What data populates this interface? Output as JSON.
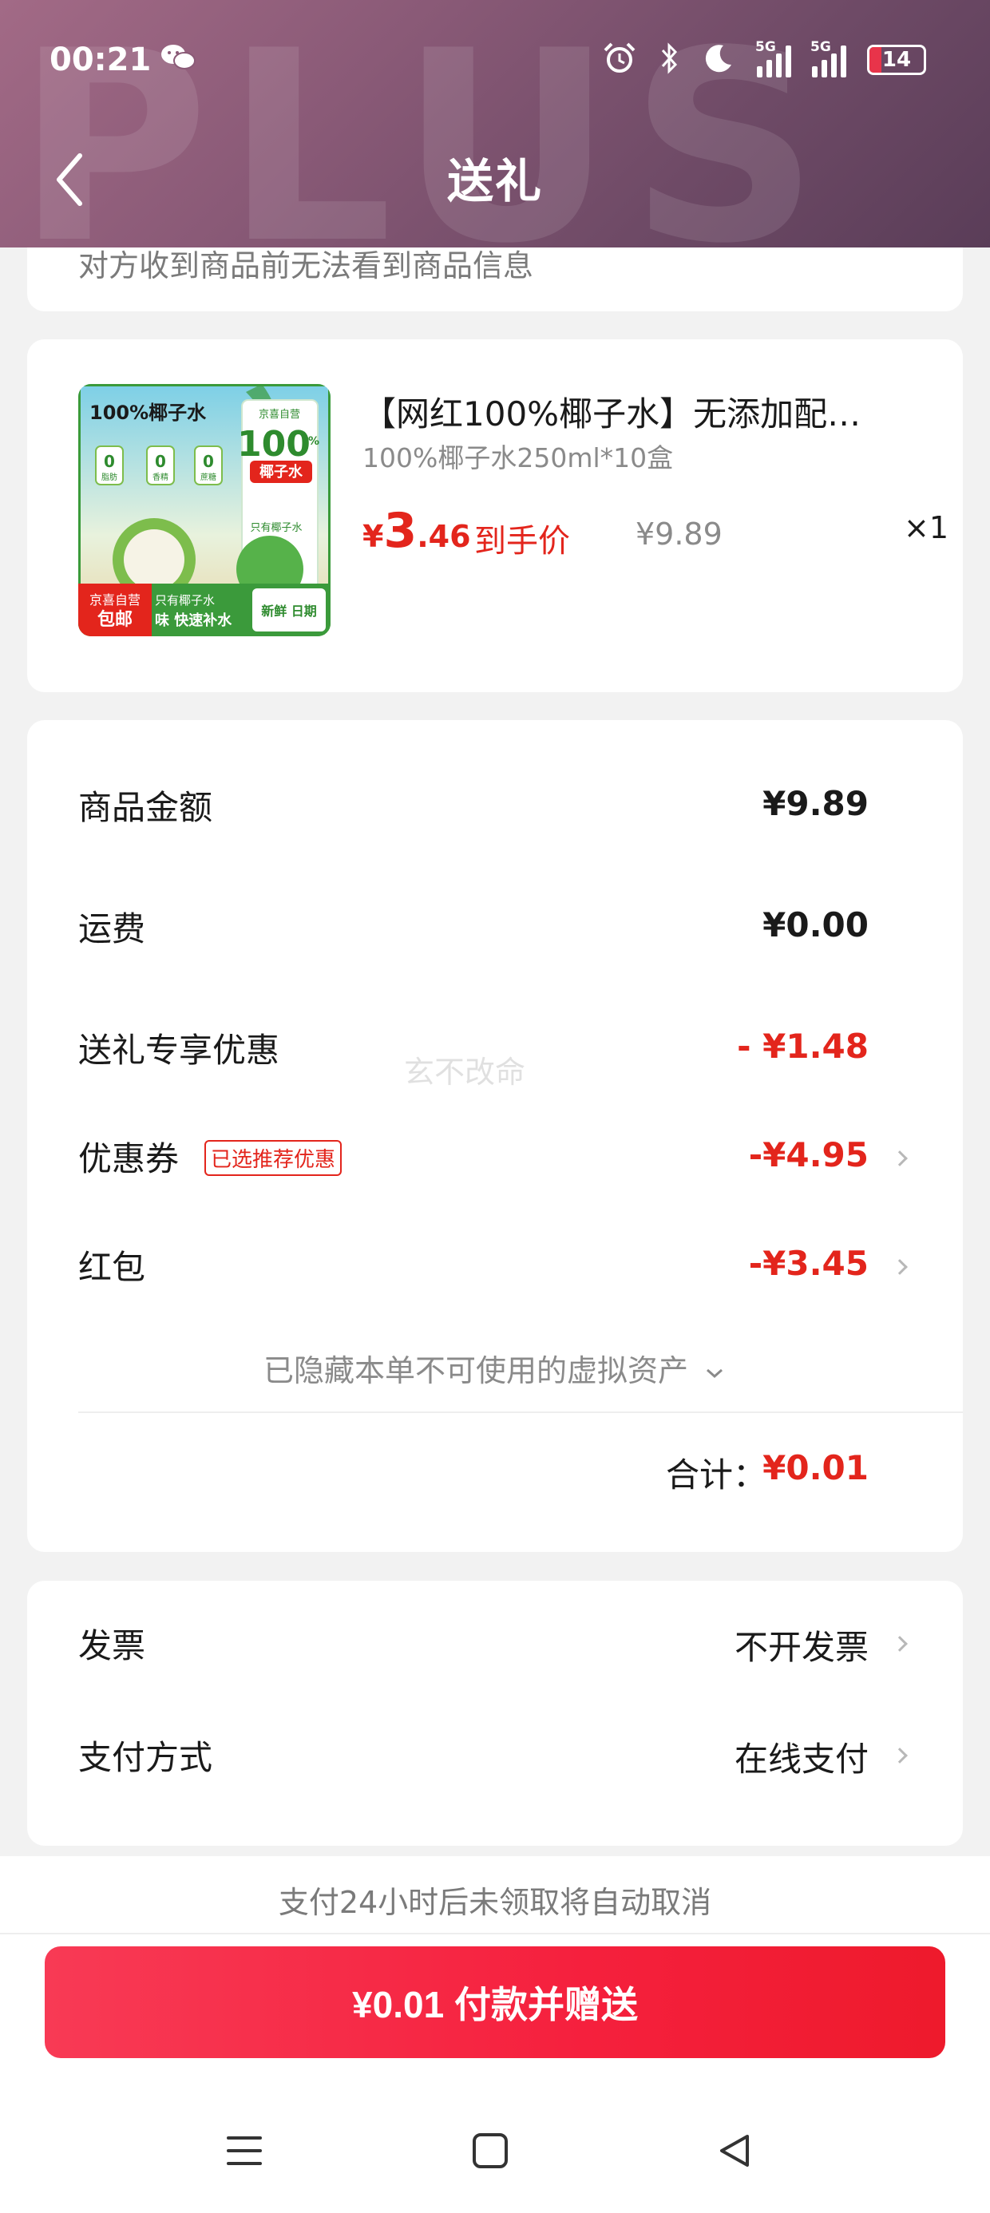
{
  "status_bar": {
    "time": "00:21",
    "signal1_label": "5G",
    "signal2_label": "5G",
    "battery": "14"
  },
  "header": {
    "title": "送礼",
    "watermark": "PLUS"
  },
  "notice": {
    "text": "对方收到商品前无法看到商品信息"
  },
  "product": {
    "title": "【网红100%椰子水】无添加配…",
    "spec": "100%椰子水250ml*10盒",
    "price_currency": "¥",
    "price_int": "3",
    "price_dec": ".46",
    "price_label": "到手价",
    "original_price": "¥9.89",
    "quantity": "×1",
    "image": {
      "banner": "100%椰子水",
      "badge_top": "只有椰子水",
      "big": "100",
      "big_suffix": "%",
      "pill": "椰子水",
      "small1": "0",
      "small1_label": "脂肪",
      "small2": "0",
      "small2_label": "香精",
      "small3": "0",
      "small3_label": "蔗糖",
      "bottom_left_top": "京喜自营",
      "bottom_left": "包邮",
      "bottom_mid1": "只有椰子水",
      "bottom_mid2": "味 快速补水",
      "bottom_right": "新鲜 日期"
    }
  },
  "summary": {
    "rows": [
      {
        "label": "商品金额",
        "value": "¥9.89"
      },
      {
        "label": "运费",
        "value": "¥0.00"
      },
      {
        "label": "送礼专享优惠",
        "value": "- ¥1.48"
      },
      {
        "label": "优惠券",
        "value": "-¥4.95"
      },
      {
        "label": "红包",
        "value": "-¥3.45"
      }
    ],
    "coupon_badge": "已选推荐优惠",
    "hidden_assets": "已隐藏本单不可使用的虚拟资产",
    "total_label": "合计：",
    "total_value": "¥0.01",
    "watermark": "玄不改命"
  },
  "invoice": {
    "rows": [
      {
        "label": "发票",
        "value": "不开发票"
      },
      {
        "label": "支付方式",
        "value": "在线支付"
      }
    ]
  },
  "footer": {
    "note": "支付24小时后未领取将自动取消",
    "pay_button": "¥0.01 付款并赠送"
  },
  "colors": {
    "accent_red": "#e3251c",
    "button_red": "#f5203d",
    "header_purple": "#8a5a77"
  }
}
